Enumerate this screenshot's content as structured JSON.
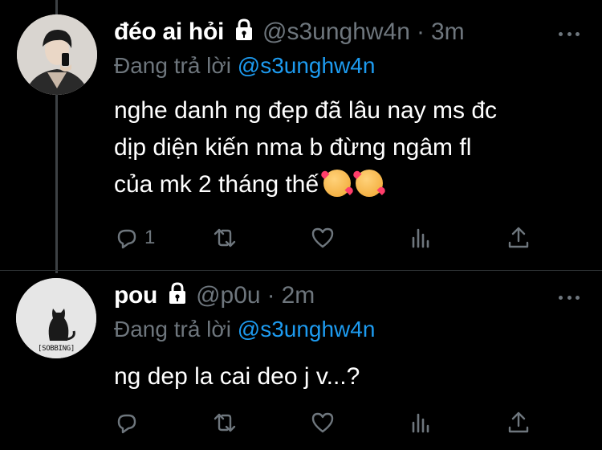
{
  "tweets": [
    {
      "name": "đéo ai hỏi",
      "handle": "@s3unghw4n",
      "separator": "·",
      "time": "3m",
      "reply_prefix": "Đang trả lời",
      "reply_handle": "@s3unghw4n",
      "lines": [
        "nghe danh ng đẹp đã lâu nay ms đc",
        "dịp diện kiến nma b đừng ngâm fl",
        "của mk 2 tháng thế"
      ],
      "emoji": [
        "smiling-face-with-hearts-emoji",
        "smiling-face-with-hearts-emoji"
      ],
      "reply_count": "1"
    },
    {
      "name": "pou",
      "handle": "@p0u",
      "separator": "·",
      "time": "2m",
      "reply_prefix": "Đang trả lời",
      "reply_handle": "@s3unghw4n",
      "lines": [
        "ng dep la cai deo j v...?"
      ],
      "avatar_caption": "[SOBBING]"
    }
  ],
  "colors": {
    "background": "#000000",
    "secondary_text": "#6e767d",
    "mention": "#1d9bf0",
    "thread_line": "#3d4144"
  }
}
